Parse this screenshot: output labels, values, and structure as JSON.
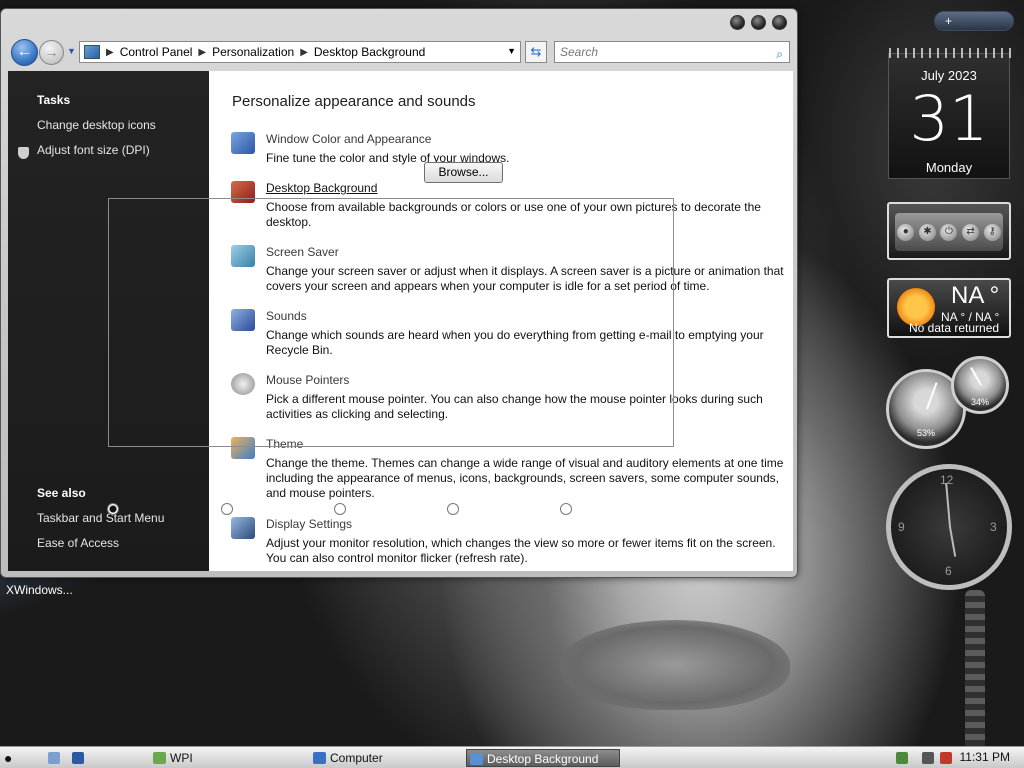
{
  "window": {
    "breadcrumb": [
      "Control Panel",
      "Personalization",
      "Desktop Background"
    ],
    "search_placeholder": "Search"
  },
  "left_pane": {
    "tasks_heading": "Tasks",
    "tasks": [
      "Change desktop icons",
      "Adjust font size (DPI)"
    ],
    "see_also_heading": "See also",
    "see_also": [
      "Taskbar and Start Menu",
      "Ease of Access"
    ]
  },
  "main": {
    "title": "Personalize appearance and sounds",
    "browse_label": "Browse...",
    "items": [
      {
        "title": "Window Color and Appearance",
        "desc": "Fine tune the color and style of your windows.",
        "icon_color": "#3b6fc2"
      },
      {
        "title": "Desktop Background",
        "desc": "Choose from available backgrounds or colors or use one of your own pictures to decorate the desktop.",
        "icon_color": "#b23a2a"
      },
      {
        "title": "Screen Saver",
        "desc": "Change your screen saver or adjust when it displays. A screen saver is a picture or animation that covers your screen and appears when your computer is idle for a set period of time.",
        "icon_color": "#4e8fb0"
      },
      {
        "title": "Sounds",
        "desc": "Change which sounds are heard when you do everything from getting e-mail to emptying your Recycle Bin.",
        "icon_color": "#3a5ca8"
      },
      {
        "title": "Mouse Pointers",
        "desc": "Pick a different mouse pointer. You can also change how the mouse pointer looks during such activities as clicking and selecting.",
        "icon_color": "#9a9a9a"
      },
      {
        "title": "Theme",
        "desc": "Change the theme. Themes can change a wide range of visual and auditory elements at one time including the appearance of menus, icons, backgrounds, screen savers, some computer sounds, and mouse pointers.",
        "icon_color": "#d8842a"
      },
      {
        "title": "Display Settings",
        "desc": "Adjust your monitor resolution, which changes the view so more or fewer items fit on the screen. You can also control monitor flicker (refresh rate).",
        "icon_color": "#5a7fae"
      }
    ]
  },
  "desktop": {
    "xwindows_label": "XWindows...",
    "gadget_bar_label": "+"
  },
  "gadgets": {
    "calendar": {
      "month": "July 2023",
      "day": "31",
      "weekday": "Monday"
    },
    "weather": {
      "temp": "NA °",
      "sub": "NA ° / NA °",
      "status": "No data returned"
    },
    "cpu_gauge": "53%",
    "mem_gauge": "34%",
    "clock_numbers": [
      "12",
      "3",
      "6",
      "9"
    ]
  },
  "taskbar": {
    "items": [
      {
        "label": "WPI",
        "active": false
      },
      {
        "label": "Computer",
        "active": false
      },
      {
        "label": "Desktop Background",
        "active": true
      }
    ],
    "clock": "11:31 PM"
  }
}
